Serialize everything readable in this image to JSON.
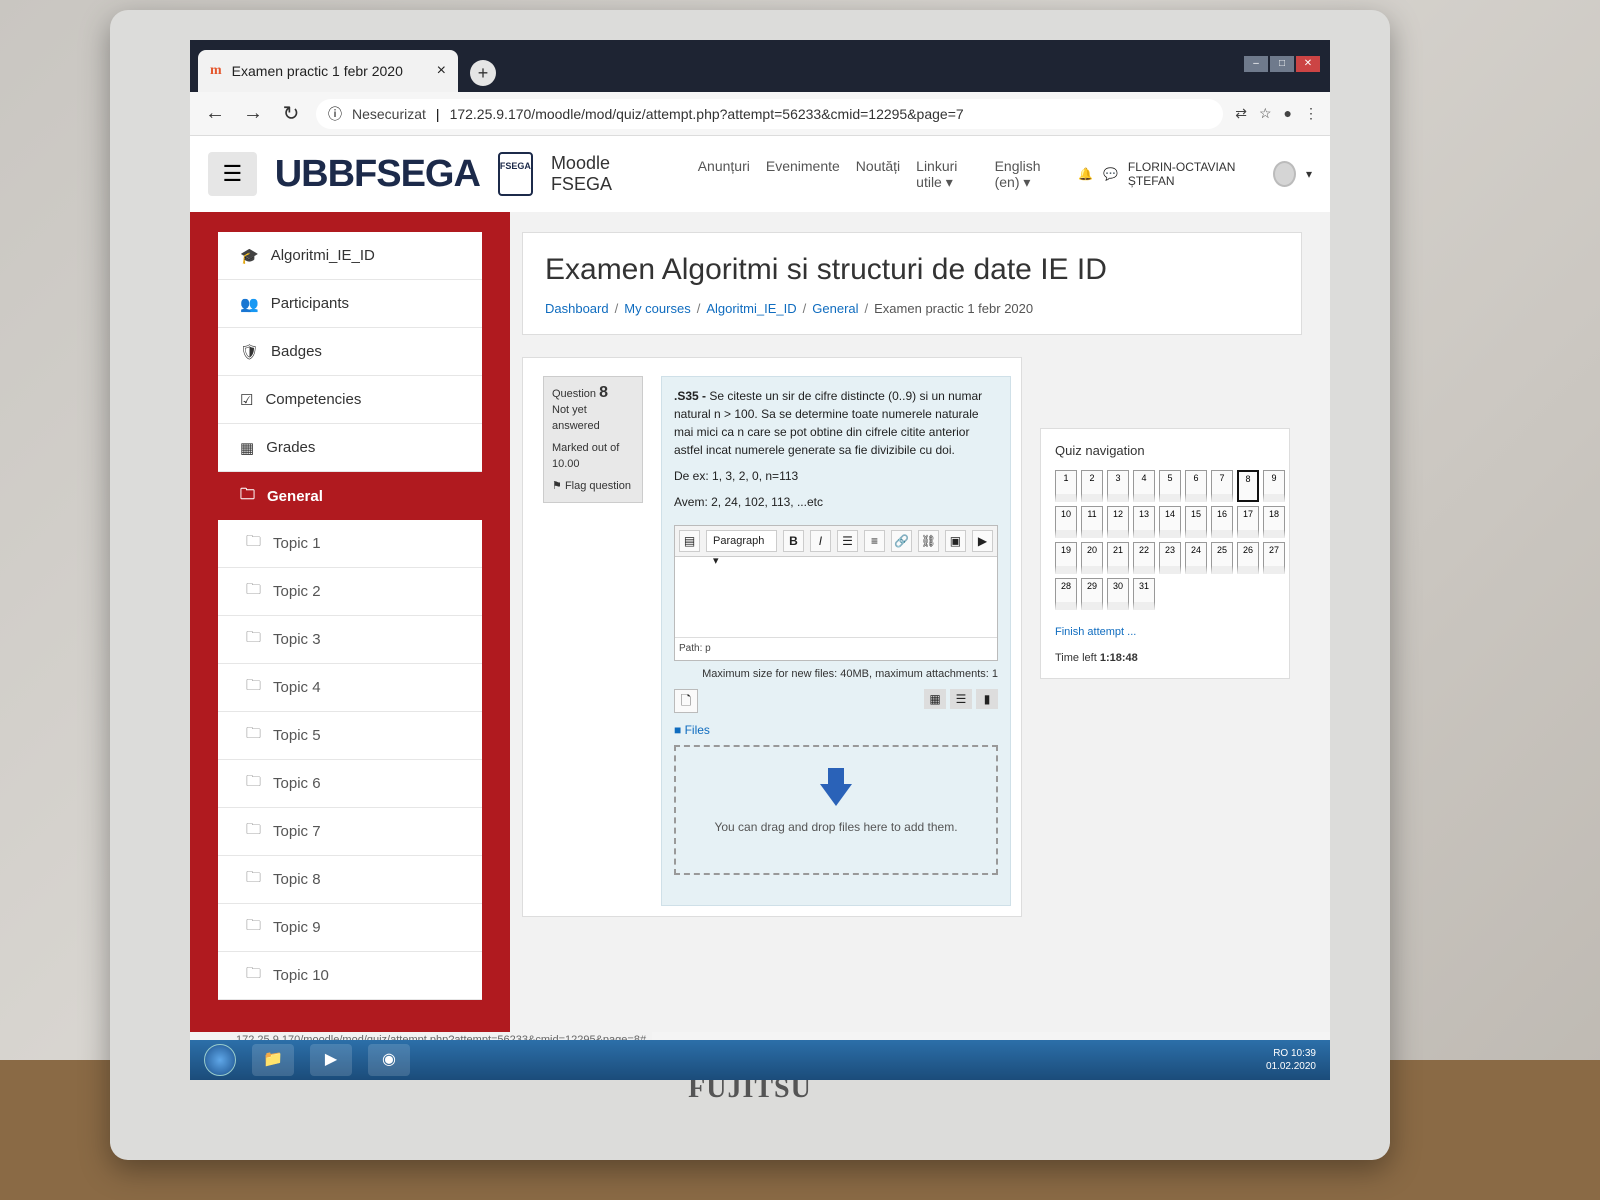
{
  "browser": {
    "tab_title": "Examen practic 1 febr 2020",
    "tab_close": "×",
    "new_tab": "+",
    "security_label": "Nesecurizat",
    "url": "172.25.9.170/moodle/mod/quiz/attempt.php?attempt=56233&cmid=12295&page=7"
  },
  "navbar": {
    "logo": "UBBFSEGA",
    "logo_badge": "FSEGA",
    "site_name": "Moodle FSEGA",
    "links": [
      "Anunțuri",
      "Evenimente",
      "Noutăți",
      "Linkuri utile ▾",
      "English (en) ▾"
    ],
    "user_name": "FLORIN-OCTAVIAN ȘTEFAN"
  },
  "drawer": {
    "course_items": [
      {
        "icon": "🎓",
        "label": "Algoritmi_IE_ID"
      },
      {
        "icon": "👥",
        "label": "Participants"
      },
      {
        "icon": "🛡",
        "label": "Badges"
      },
      {
        "icon": "☑",
        "label": "Competencies"
      },
      {
        "icon": "▦",
        "label": "Grades"
      }
    ],
    "active_item": {
      "icon": "🗀",
      "label": "General"
    },
    "topics": [
      "Topic 1",
      "Topic 2",
      "Topic 3",
      "Topic 4",
      "Topic 5",
      "Topic 6",
      "Topic 7",
      "Topic 8",
      "Topic 9",
      "Topic 10"
    ]
  },
  "page": {
    "title": "Examen Algoritmi si structuri de date IE ID",
    "breadcrumb": [
      "Dashboard",
      "My courses",
      "Algoritmi_IE_ID",
      "General",
      "Examen practic 1 febr 2020"
    ]
  },
  "question": {
    "label": "Question",
    "number": "8",
    "state": "Not yet answered",
    "marked": "Marked out of 10.00",
    "flag": "Flag question",
    "code": ".S35 -",
    "text": "Se citeste un sir de cifre distincte (0..9) si un numar natural n > 100. Sa se determine toate numerele naturale mai mici ca n care se pot obtine din cifrele citite anterior astfel incat numerele generate sa fie divizibile cu doi.",
    "example": "De ex: 1, 3, 2, 0, n=113",
    "result": "Avem: 2, 24, 102, 113, ...etc",
    "editor_format": "Paragraph",
    "editor_path": "Path: p",
    "max_size": "Maximum size for new files: 40MB, maximum attachments: 1",
    "files_label": "Files",
    "drop_text": "You can drag and drop files here to add them."
  },
  "quiz_nav": {
    "title": "Quiz navigation",
    "questions": [
      "1",
      "2",
      "3",
      "4",
      "5",
      "6",
      "7",
      "8",
      "9",
      "10",
      "11",
      "12",
      "13",
      "14",
      "15",
      "16",
      "17",
      "18",
      "19",
      "20",
      "21",
      "22",
      "23",
      "24",
      "25",
      "26",
      "27",
      "28",
      "29",
      "30",
      "31"
    ],
    "current": "8",
    "finish": "Finish attempt ...",
    "time_label": "Time left",
    "time_value": "1:18:48"
  },
  "status_url": "172.25.9.170/moodle/mod/quiz/attempt.php?attempt=56233&cmid=12295&page=8#",
  "taskbar": {
    "time": "10:39",
    "date": "01.02.2020",
    "lang": "RO"
  },
  "monitor_brand": "FUJITSU",
  "colors": {
    "drawer": "#b01a1f",
    "link": "#0f6cbf",
    "question_bg": "#e6f1f5"
  }
}
